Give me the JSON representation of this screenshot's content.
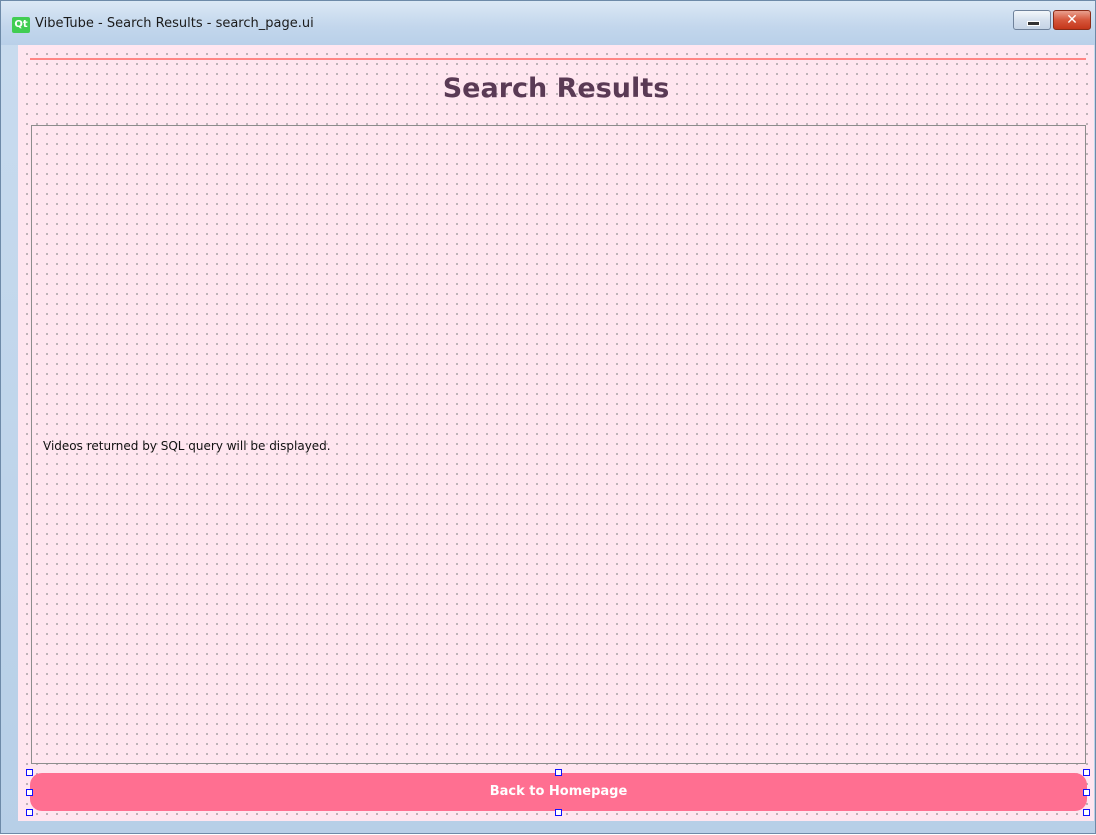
{
  "window": {
    "app_icon": "qt-logo-icon",
    "app_icon_text": "Qt",
    "title": "VibeTube - Search Results - search_page.ui",
    "minimize_icon": "minimize-icon",
    "close_icon": "close-icon",
    "close_glyph": "✕"
  },
  "page": {
    "title": "Search Results",
    "results_placeholder": "Videos returned by SQL query will be displayed.",
    "back_button_label": "Back to Homepage"
  },
  "colors": {
    "background": "#ffe6f0",
    "accent_line": "#ff8585",
    "title_text": "#5a3a55",
    "button": "#ff6f91",
    "button_text": "#ffffff",
    "selection_handle": "#1010ff"
  }
}
